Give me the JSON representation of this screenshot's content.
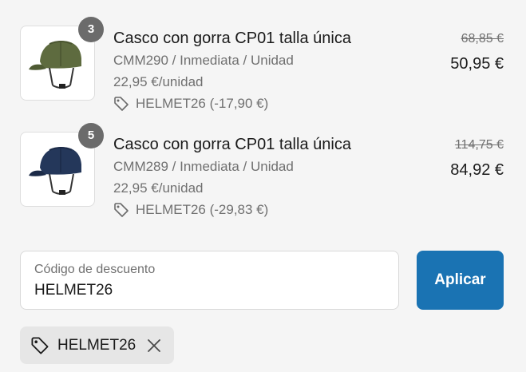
{
  "items": [
    {
      "quantity": "3",
      "title": "Casco con gorra CP01 talla única",
      "meta": "CMM290 / Inmediata / Unidad",
      "unit_price": "22,95 €/unidad",
      "discount": "HELMET26 (-17,90 €)",
      "old_price": "68,85 €",
      "price": "50,95 €",
      "color": "#5e6b3f",
      "icon": "tag-icon"
    },
    {
      "quantity": "5",
      "title": "Casco con gorra CP01 talla única",
      "meta": "CMM289 / Inmediata / Unidad",
      "unit_price": "22,95 €/unidad",
      "discount": "HELMET26 (-29,83 €)",
      "old_price": "114,75 €",
      "price": "84,92 €",
      "color": "#24375a",
      "icon": "tag-icon"
    }
  ],
  "discount_field": {
    "label": "Código de descuento",
    "value": "HELMET26"
  },
  "apply_button": {
    "label": "Aplicar",
    "color": "#1a73b3"
  },
  "applied_code": {
    "label": "HELMET26",
    "icon": "tag-icon",
    "remove_icon": "close-icon"
  }
}
